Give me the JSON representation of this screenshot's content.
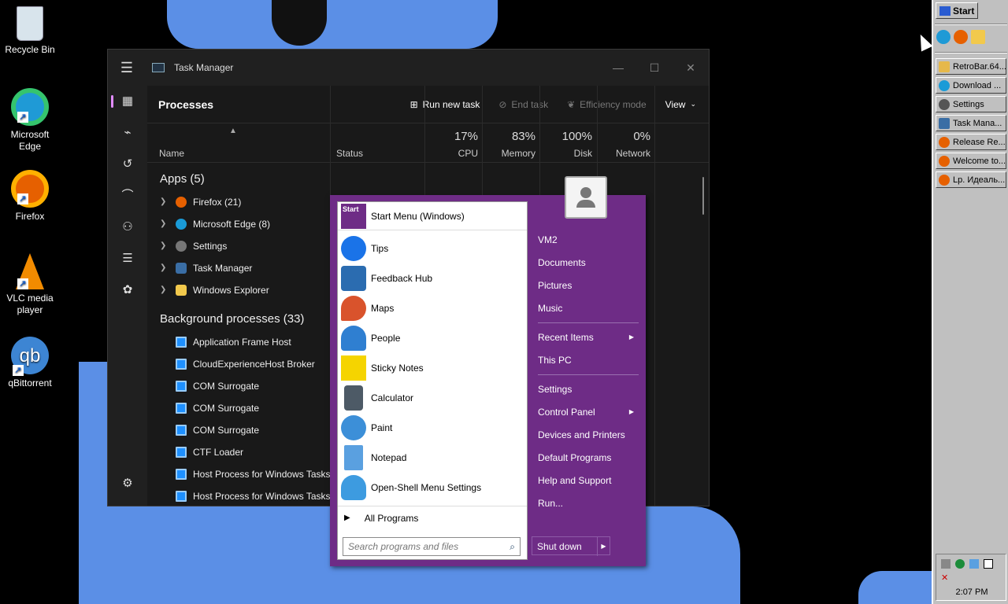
{
  "desktop": {
    "icons": [
      {
        "label": "Recycle Bin",
        "icon": "recycle-bin-icon"
      },
      {
        "label": "Microsoft Edge",
        "icon": "edge-icon"
      },
      {
        "label": "Firefox",
        "icon": "firefox-icon"
      },
      {
        "label": "VLC media player",
        "icon": "vlc-icon"
      },
      {
        "label": "qBittorrent",
        "icon": "qbittorrent-icon",
        "glyph": "qb"
      }
    ]
  },
  "task_manager": {
    "title": "Task Manager",
    "window_controls": {
      "minimize": "—",
      "maximize": "☐",
      "close": "✕"
    },
    "rail_icons": [
      "processes-icon",
      "performance-icon",
      "app-history-icon",
      "startup-apps-icon",
      "users-icon",
      "details-icon",
      "services-icon"
    ],
    "rail_settings": "settings-icon",
    "section": "Processes",
    "toolbar": {
      "run_new_task": "Run new task",
      "end_task": "End task",
      "efficiency_mode": "Efficiency mode",
      "view": "View"
    },
    "columns": {
      "name": "Name",
      "status": "Status",
      "cpu": {
        "pct": "17%",
        "label": "CPU"
      },
      "memory": {
        "pct": "83%",
        "label": "Memory"
      },
      "disk": {
        "pct": "100%",
        "label": "Disk"
      },
      "network": {
        "pct": "0%",
        "label": "Network"
      }
    },
    "apps_header": "Apps (5)",
    "apps": [
      {
        "name": "Firefox (21)",
        "color": "#e66000"
      },
      {
        "name": "Microsoft Edge (8)",
        "color": "#1a9bd7"
      },
      {
        "name": "Settings",
        "color": "#777777"
      },
      {
        "name": "Task Manager",
        "color": "#3a6ea5"
      },
      {
        "name": "Windows Explorer",
        "color": "#f2c94c"
      }
    ],
    "bg_header": "Background processes (33)",
    "bg_processes": [
      "Application Frame Host",
      "CloudExperienceHost Broker",
      "COM Surrogate",
      "COM Surrogate",
      "COM Surrogate",
      "CTF Loader",
      "Host Process for Windows Tasks",
      "Host Process for Windows Tasks"
    ]
  },
  "start_menu": {
    "header_item": {
      "label": "Start Menu (Windows)",
      "glyph": "Start"
    },
    "programs": [
      {
        "label": "Tips",
        "color": "#1a73e8"
      },
      {
        "label": "Feedback Hub",
        "color": "#2b6cb0"
      },
      {
        "label": "Maps",
        "color": "#d9532c"
      },
      {
        "label": "People",
        "color": "#2f7fd1"
      },
      {
        "label": "Sticky Notes",
        "color": "#f5d400"
      },
      {
        "label": "Calculator",
        "color": "#4d5a66"
      },
      {
        "label": "Paint",
        "color": "#3c8fd8"
      },
      {
        "label": "Notepad",
        "color": "#5aa0e0"
      },
      {
        "label": "Open-Shell Menu Settings",
        "color": "#3d9be0"
      }
    ],
    "all_programs": "All Programs",
    "search_placeholder": "Search programs and files",
    "right": {
      "user": "VM2",
      "documents": "Documents",
      "pictures": "Pictures",
      "music": "Music",
      "recent_items": "Recent Items",
      "this_pc": "This PC",
      "settings": "Settings",
      "control_panel": "Control Panel",
      "devices_printers": "Devices and Printers",
      "default_programs": "Default Programs",
      "help_support": "Help and Support",
      "run": "Run...",
      "shut_down": "Shut down"
    }
  },
  "retrobar": {
    "start": "Start",
    "quick_launch": [
      "edge-icon",
      "firefox-icon",
      "explorer-icon"
    ],
    "tasks": [
      {
        "label": "RetroBar.64...",
        "color": "#e6b84a"
      },
      {
        "label": "Download ...",
        "color": "#1a9bd7"
      },
      {
        "label": "Settings",
        "color": "#555555"
      },
      {
        "label": "Task Mana...",
        "color": "#3a6ea5"
      },
      {
        "label": "Release Re...",
        "color": "#e66000"
      },
      {
        "label": "Welcome to...",
        "color": "#e66000"
      },
      {
        "label": "Lp. Идеаль...",
        "color": "#e66000"
      }
    ],
    "tray_icons": [
      "network-icon",
      "defender-icon",
      "display-icon",
      "monitor-icon",
      "mute-icon"
    ],
    "clock": "2:07 PM"
  }
}
